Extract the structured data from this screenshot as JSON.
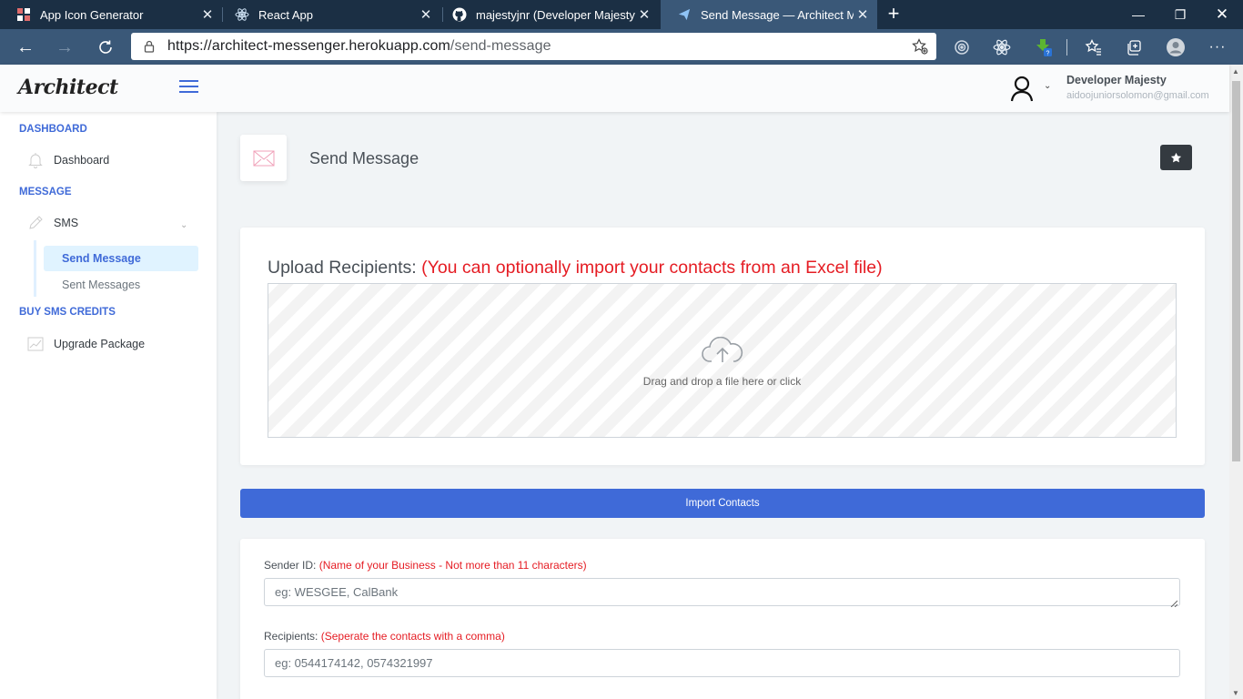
{
  "browser": {
    "tabs": [
      {
        "label": "App Icon Generator",
        "icon": "grid-app-icon",
        "active": false
      },
      {
        "label": "React App",
        "icon": "react-icon",
        "active": false
      },
      {
        "label": "majestyjnr (Developer Majesty)",
        "icon": "github-icon",
        "active": false
      },
      {
        "label": "Send Message — Architect Messenger",
        "icon": "paper-plane-icon",
        "active": true
      }
    ],
    "url_host": "https://architect-messenger.herokuapp.com",
    "url_path": "/send-message"
  },
  "header": {
    "logo": "Architect",
    "user_name": "Developer Majesty",
    "user_email": "aidoojuniorsolomon@gmail.com"
  },
  "sidebar": {
    "dashboard_heading": "DASHBOARD",
    "dashboard_item": "Dashboard",
    "message_heading": "MESSAGE",
    "sms_item": "SMS",
    "send_message": "Send Message",
    "sent_messages": "Sent Messages",
    "buy_heading": "BUY SMS CREDITS",
    "upgrade_item": "Upgrade Package"
  },
  "page": {
    "title": "Send Message",
    "upload_title": "Upload Recipients:",
    "upload_note": "(You can optionally import your contacts from an Excel file)",
    "drop_text": "Drag and drop a file here or click",
    "import_button": "Import Contacts",
    "sender_label": "Sender ID:",
    "sender_note": "(Name of your Business - Not more than 11 characters)",
    "sender_placeholder": "eg: WESGEE, CalBank",
    "recipients_label": "Recipients:",
    "recipients_note": "(Seperate the contacts with a comma)",
    "recipients_placeholder": "eg: 0544174142, 0574321997"
  },
  "colors": {
    "accent": "#3f6ad8",
    "note_red": "#e51c23",
    "tabbar": "#1b2f44",
    "toolbar": "#3a5878"
  }
}
